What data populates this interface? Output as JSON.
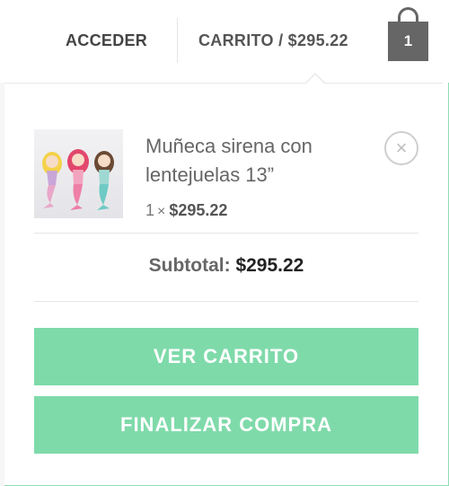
{
  "header": {
    "login_label": "ACCEDER",
    "cart_label": "CARRITO / $295.22",
    "cart_count": "1"
  },
  "cart": {
    "items": [
      {
        "name": "Muñeca sirena con lentejuelas 13”",
        "quantity": "1",
        "quantity_separator": "×",
        "price": "$295.22",
        "remove_symbol": "×"
      }
    ],
    "subtotal_label": "Subtotal:",
    "subtotal_value": "$295.22",
    "view_cart_label": "VER CARRITO",
    "checkout_label": "FINALIZAR COMPRA"
  },
  "colors": {
    "accent_green": "#7fdaaa",
    "bag_gray": "#666666",
    "frame_green": "#8fdcb4"
  },
  "icons": {
    "cart": "shopping-bag-icon",
    "remove": "close-circle-icon"
  }
}
